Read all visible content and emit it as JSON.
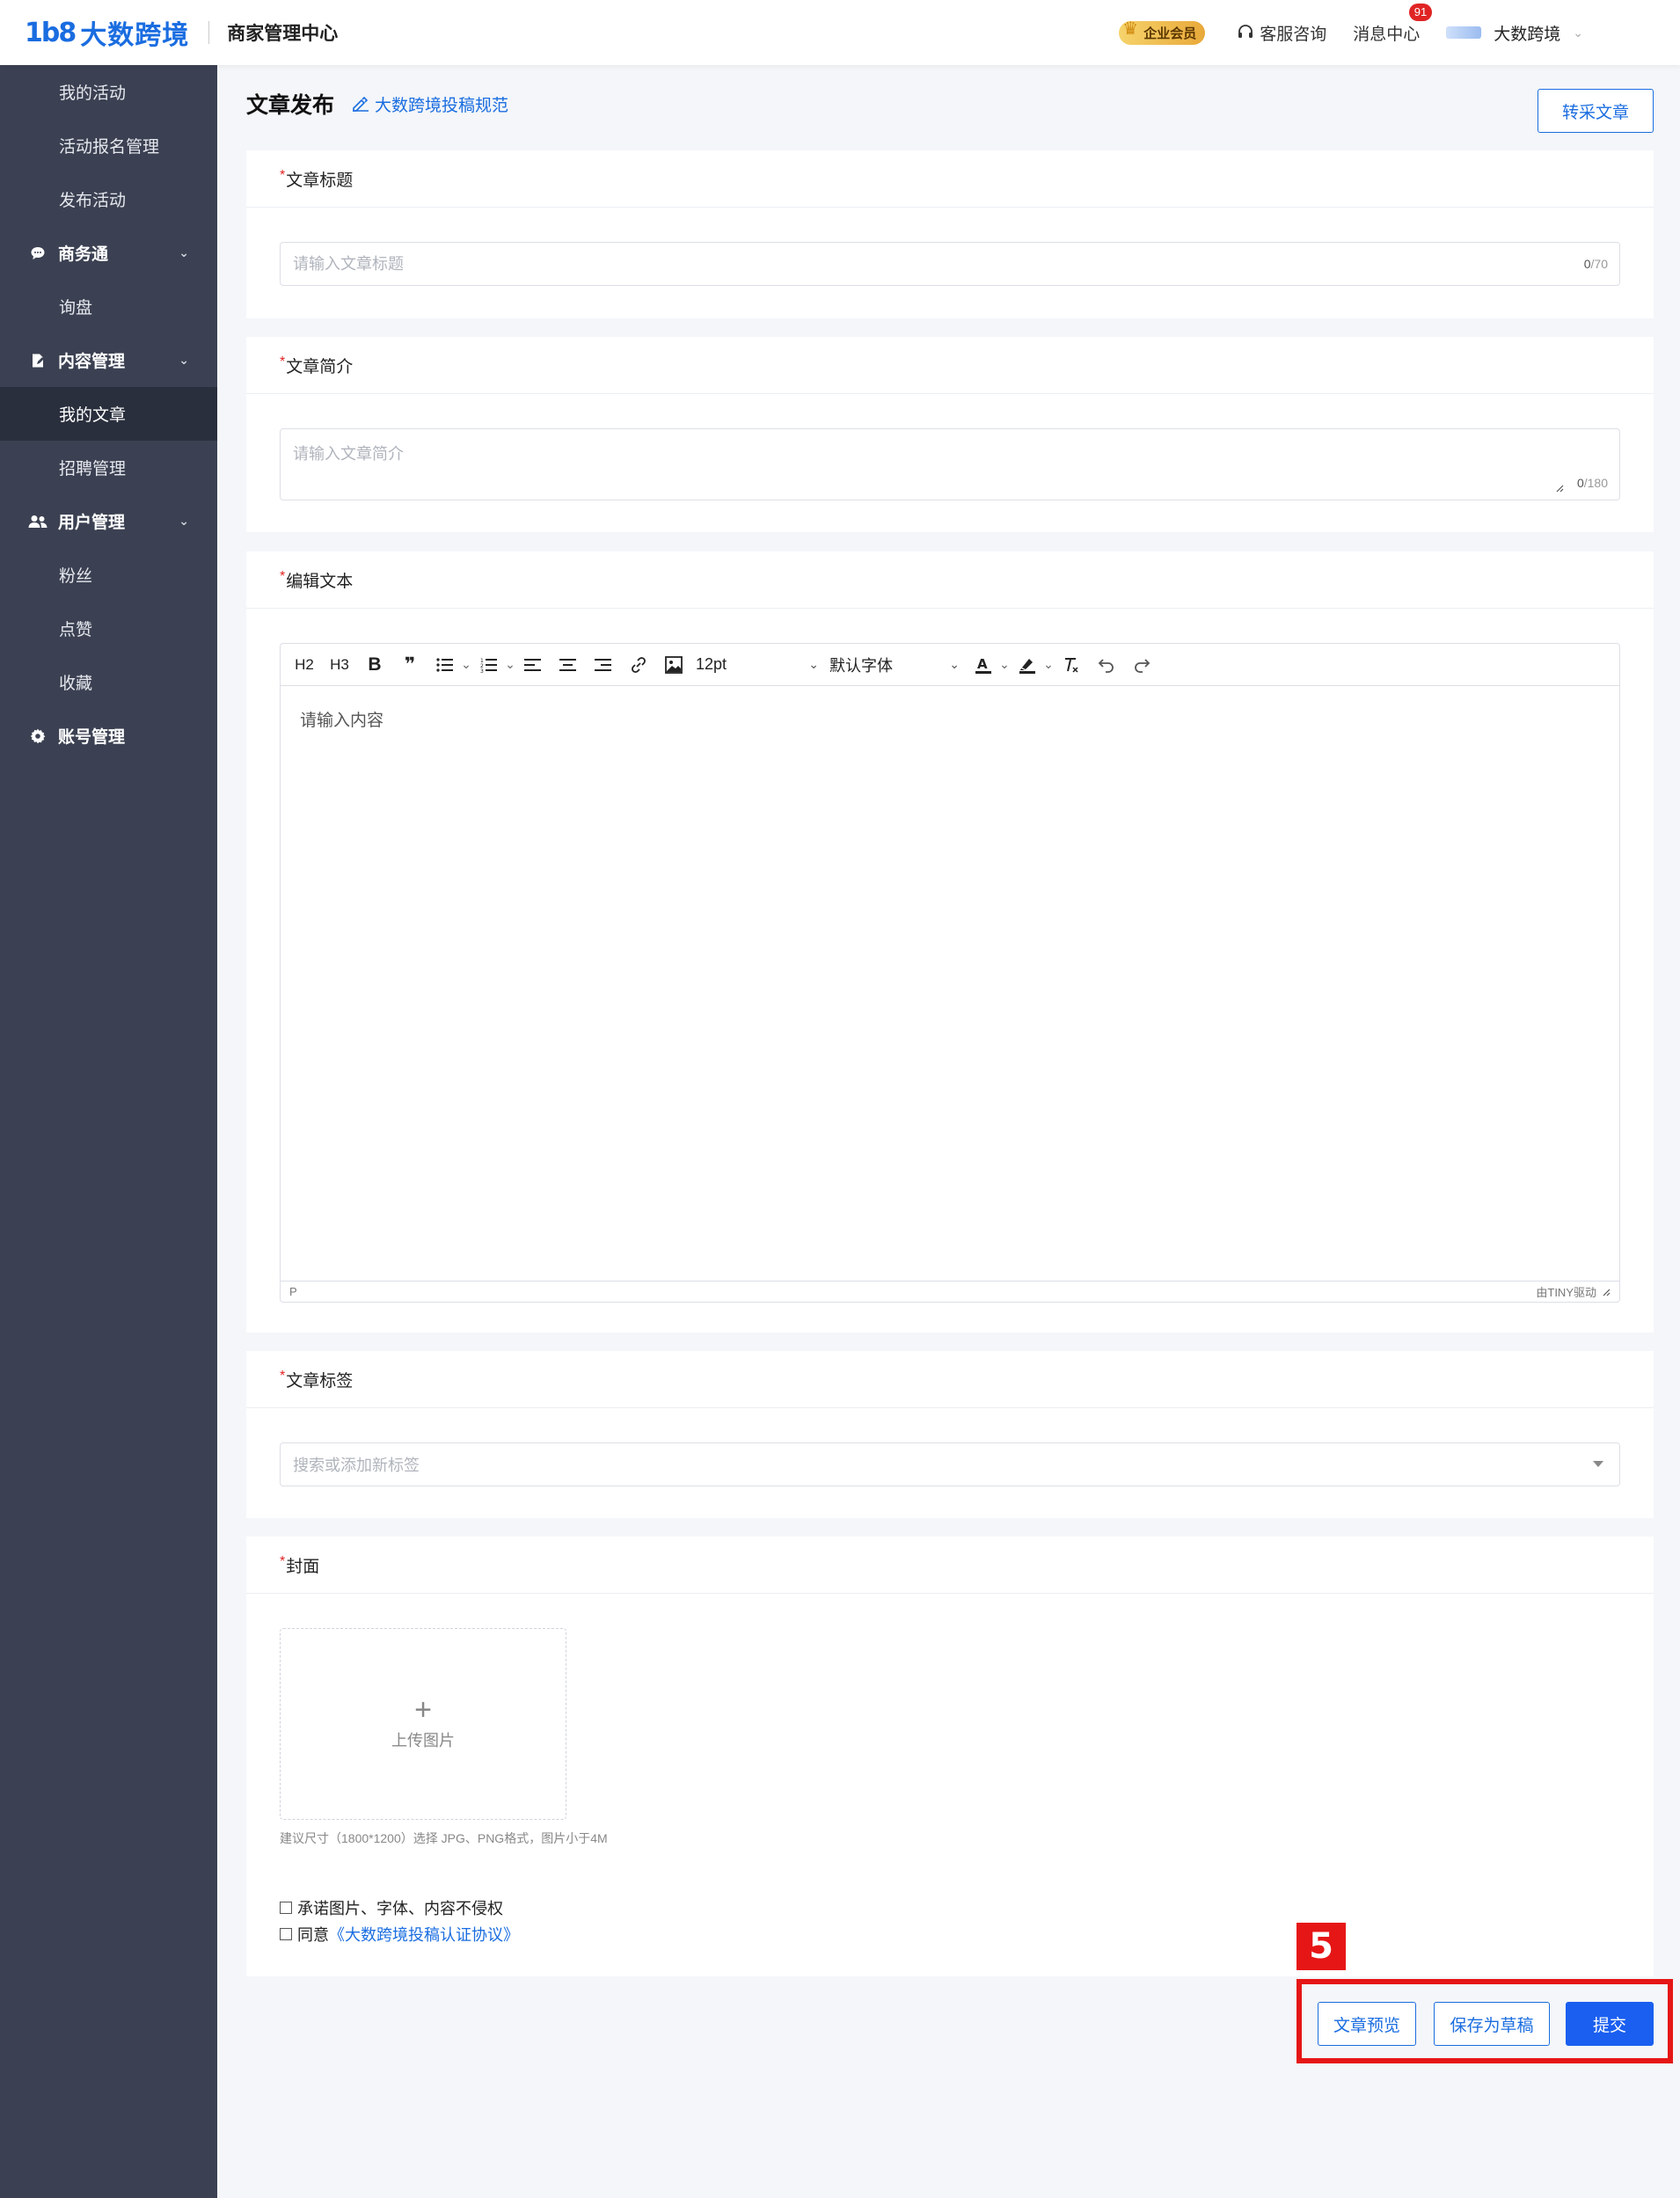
{
  "header": {
    "logo_mark": "1b8",
    "logo_text": "大数跨境",
    "app_title": "商家管理中心",
    "vip_label": "企业会员",
    "support_label": "客服咨询",
    "messages_label": "消息中心",
    "messages_count": "91",
    "user_name": "大数跨境"
  },
  "sidebar": {
    "items": [
      {
        "label": "我的活动"
      },
      {
        "label": "活动报名管理"
      },
      {
        "label": "发布活动"
      },
      {
        "label": "商务通"
      },
      {
        "label": "询盘"
      },
      {
        "label": "内容管理"
      },
      {
        "label": "我的文章"
      },
      {
        "label": "招聘管理"
      },
      {
        "label": "用户管理"
      },
      {
        "label": "粉丝"
      },
      {
        "label": "点赞"
      },
      {
        "label": "收藏"
      },
      {
        "label": "账号管理"
      }
    ]
  },
  "page": {
    "title": "文章发布",
    "guide_link": "大数跨境投稿规范",
    "reprint_button": "转采文章"
  },
  "form": {
    "required_mark": "*",
    "title_section": {
      "label": "文章标题",
      "placeholder": "请输入文章标题",
      "count": "0",
      "max": "/70"
    },
    "summary_section": {
      "label": "文章简介",
      "placeholder": "请输入文章简介",
      "count": "0",
      "max": "/180"
    },
    "editor_section": {
      "label": "编辑文本",
      "toolbar": {
        "h2": "H2",
        "h3": "H3",
        "bold": "B",
        "quote": "❞",
        "font_size": "12pt",
        "font_family": "默认字体"
      },
      "placeholder": "请输入内容",
      "status_path": "P",
      "powered_by": "由TINY驱动"
    },
    "tags_section": {
      "label": "文章标签",
      "placeholder": "搜索或添加新标签"
    },
    "cover_section": {
      "label": "封面",
      "upload_plus": "+",
      "upload_label": "上传图片",
      "hint": "建议尺寸（1800*1200）选择 JPG、PNG格式，图片小于4M",
      "check_copyright": "承诺图片、字体、内容不侵权",
      "check_agree_prefix": "同意",
      "check_agree_link": "《大数跨境投稿认证协议》"
    }
  },
  "actions": {
    "preview": "文章预览",
    "save_draft": "保存为草稿",
    "submit": "提交"
  },
  "annotation": {
    "step": "5"
  },
  "colors": {
    "brand_blue": "#1a6de0",
    "primary_button": "#1a5ff0",
    "sidebar_bg": "#3b4152",
    "annotation_red": "#e61616"
  }
}
